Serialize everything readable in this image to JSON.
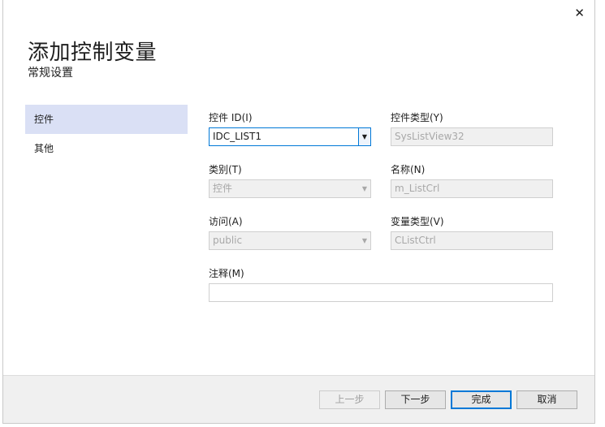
{
  "dialog": {
    "close_glyph": "✕",
    "title": "添加控制变量",
    "subtitle": "常规设置"
  },
  "nav": {
    "items": [
      {
        "label": "控件",
        "selected": true
      },
      {
        "label": "其他",
        "selected": false
      }
    ]
  },
  "form": {
    "control_id": {
      "label": "控件 ID(I)",
      "value": "IDC_LIST1"
    },
    "control_type": {
      "label": "控件类型(Y)",
      "value": "SysListView32"
    },
    "category": {
      "label": "类别(T)",
      "value": "控件"
    },
    "name": {
      "label": "名称(N)",
      "value": "m_ListCrl"
    },
    "access": {
      "label": "访问(A)",
      "value": "public"
    },
    "variable_type": {
      "label": "变量类型(V)",
      "value": "CListCtrl"
    },
    "comment": {
      "label": "注释(M)",
      "value": ""
    }
  },
  "footer": {
    "prev_label": "上一步",
    "next_label": "下一步",
    "finish_label": "完成",
    "cancel_label": "取消"
  },
  "colors": {
    "accent": "#0078d7",
    "nav_selected": "#dae0f5",
    "footer_bg": "#f0f0f0"
  }
}
